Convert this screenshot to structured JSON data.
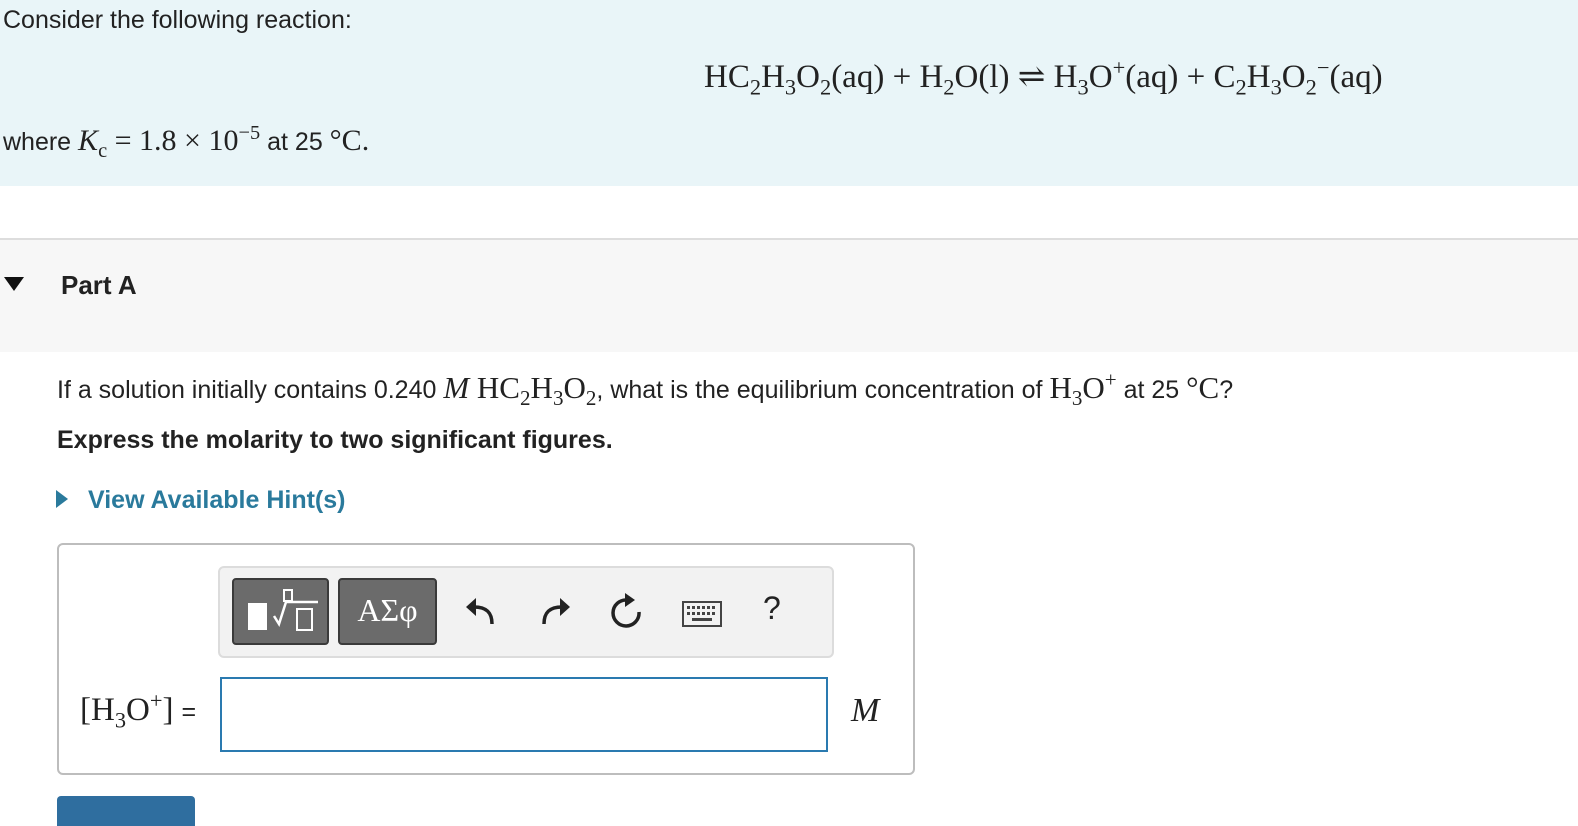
{
  "intro": {
    "title": "Consider the following reaction:",
    "equation": {
      "r1_a": "HC",
      "r1_s1": "2",
      "r1_b": "H",
      "r1_s2": "3",
      "r1_c": "O",
      "r1_s3": "2",
      "r1_phase": "(aq)",
      "plus1": " + ",
      "r2_a": "H",
      "r2_s1": "2",
      "r2_b": "O",
      "r2_phase": "(l)",
      "arrow": " ⇌ ",
      "p1_a": "H",
      "p1_s1": "3",
      "p1_b": "O",
      "p1_charge": "+",
      "p1_phase": "(aq)",
      "plus2": " + ",
      "p2_a": "C",
      "p2_s1": "2",
      "p2_b": "H",
      "p2_s2": "3",
      "p2_c": "O",
      "p2_s3": "2",
      "p2_charge": "−",
      "p2_phase": "(aq)"
    },
    "kc": {
      "prefix": "where ",
      "symbol": "K",
      "sub": "c",
      "expr": " = 1.8 × 10",
      "exp": "−5",
      "mid": " at 25 ",
      "unit": "°C",
      "suffix": "."
    }
  },
  "part": {
    "title": "Part A"
  },
  "question": {
    "pre": "If a solution initially contains 0.240 ",
    "molar": "M",
    "sp_a": " HC",
    "sp_s1": "2",
    "sp_b": "H",
    "sp_s2": "3",
    "sp_c": "O",
    "sp_s3": "2",
    "mid": ", what is the equilibrium concentration of ",
    "h_a": "H",
    "h_s1": "3",
    "h_b": "O",
    "h_charge": "+",
    "post1": " at 25 ",
    "temp": "°C",
    "post2": "?",
    "instruction": "Express the molarity to two significant figures.",
    "hint": "View Available Hint(s)"
  },
  "toolbar": {
    "greek_label": "ΑΣφ",
    "help_label": "?"
  },
  "answer": {
    "lhs_open": "[H",
    "lhs_sub": "3",
    "lhs_o": "O",
    "lhs_charge": "+",
    "lhs_close": "]",
    "equals": "=",
    "value": "",
    "unit": "M"
  },
  "icons": {
    "templates": "templates-icon",
    "undo": "undo-icon",
    "redo": "redo-icon",
    "reset": "reset-icon",
    "keyboard": "keyboard-icon"
  },
  "colors": {
    "intro_bg": "#e9f5f8",
    "link": "#2a7a9c",
    "input_border": "#2a7ab0",
    "submit": "#2f6e9f"
  }
}
